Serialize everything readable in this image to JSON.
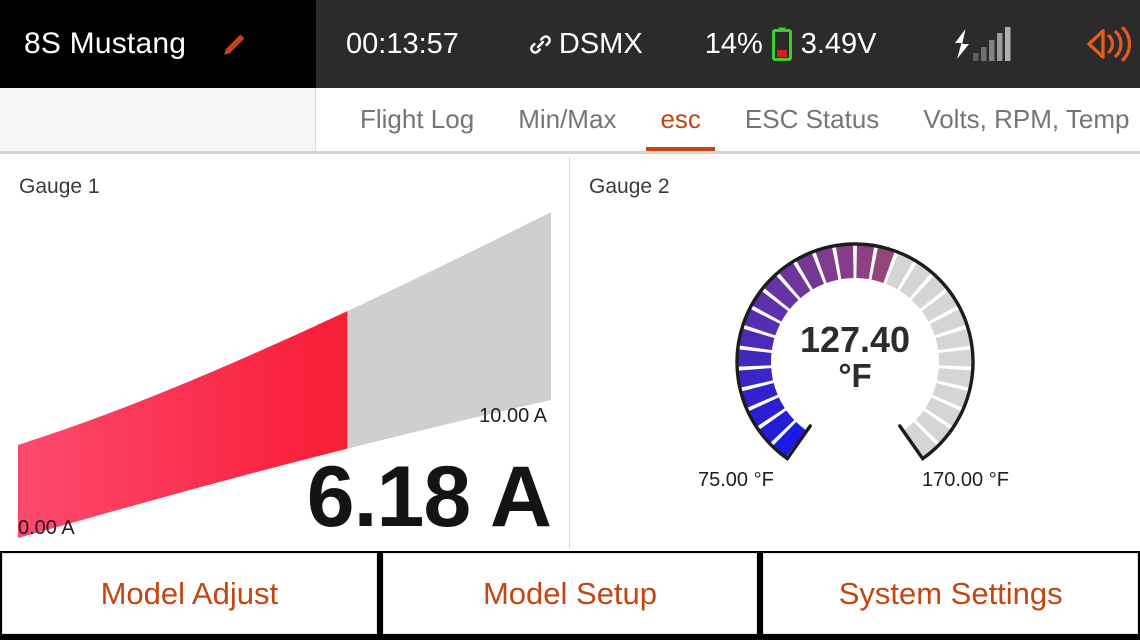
{
  "statusbar": {
    "model_name": "8S Mustang",
    "edit_icon": "pencil-icon",
    "timer": "00:13:57",
    "protocol": "DSMX",
    "protocol_icon": "link-icon",
    "battery_percent": "14%",
    "battery_icon": "battery-icon",
    "battery_voltage": "3.49V",
    "signal_icon": "signal-bars-icon",
    "audio_icon": "speaker-icon",
    "colors": {
      "bar_bg": "#2b2b2b",
      "model_bg": "#000000",
      "accent": "#c4450f",
      "battery_outline": "#3ecf2c"
    }
  },
  "tabs": [
    {
      "label": "Flight Log",
      "active": false
    },
    {
      "label": "Min/Max",
      "active": false
    },
    {
      "label": "esc",
      "active": true
    },
    {
      "label": "ESC Status",
      "active": false
    },
    {
      "label": "Volts, RPM, Temp",
      "active": false
    }
  ],
  "gauge1": {
    "title": "Gauge 1",
    "value_text": "6.18 A",
    "min_text": "0.00 A",
    "max_text": "10.00 A",
    "value": 6.18,
    "min": 0.0,
    "max": 10.0,
    "unit": "A",
    "fill_fraction": 0.618,
    "colors": {
      "start": "#fa3b63",
      "end": "#fa2220",
      "track": "#cfcfcf"
    }
  },
  "gauge2": {
    "title": "Gauge 2",
    "value_text": "127.40",
    "unit_text": "°F",
    "min_text": "75.00 °F",
    "max_text": "170.00 °F",
    "value": 127.4,
    "min": 75.0,
    "max": 170.0,
    "unit": "°F",
    "fill_fraction": 0.5516,
    "segments": 28,
    "colors": {
      "start": "#1a1ae0",
      "mid": "#8a3f86",
      "end": "#f07814",
      "track": "#d5d5d5",
      "outline": "#1c1c1c"
    }
  },
  "bottom_buttons": [
    {
      "label": "Model Adjust"
    },
    {
      "label": "Model Setup"
    },
    {
      "label": "System Settings"
    }
  ]
}
